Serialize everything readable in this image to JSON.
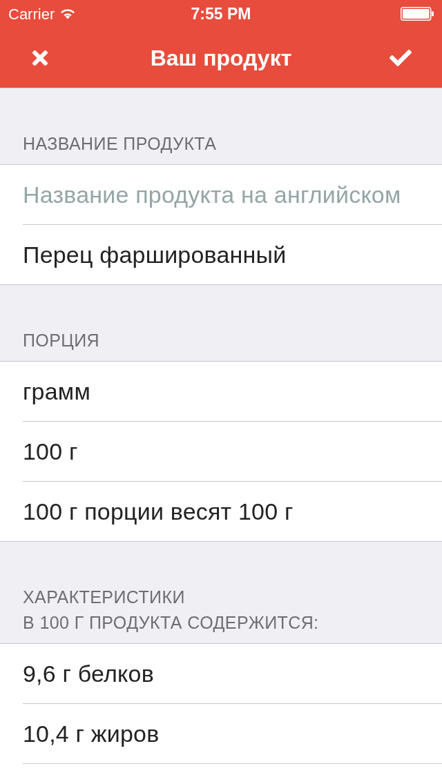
{
  "status_bar": {
    "carrier": "Carrier",
    "time": "7:55 PM"
  },
  "nav_bar": {
    "title": "Ваш продукт"
  },
  "sections": [
    {
      "header": [
        "НАЗВАНИЕ ПРОДУКТА"
      ],
      "rows": [
        {
          "kind": "field",
          "placeholder": "Название продукта на английском"
        },
        {
          "kind": "field",
          "value": "Перец фаршированный"
        }
      ]
    },
    {
      "header": [
        "ПОРЦИЯ"
      ],
      "rows": [
        {
          "kind": "text",
          "text": "грамм"
        },
        {
          "kind": "text",
          "text": "100 г"
        },
        {
          "kind": "text",
          "text": "100 г порции весят 100 г"
        }
      ]
    },
    {
      "header": [
        "ХАРАКТЕРИСТИКИ",
        "В 100 Г ПРОДУКТА СОДЕРЖИТСЯ:"
      ],
      "rows": [
        {
          "kind": "text",
          "text": "9,6 г белков"
        },
        {
          "kind": "text",
          "text": "10,4 г жиров"
        }
      ]
    }
  ]
}
